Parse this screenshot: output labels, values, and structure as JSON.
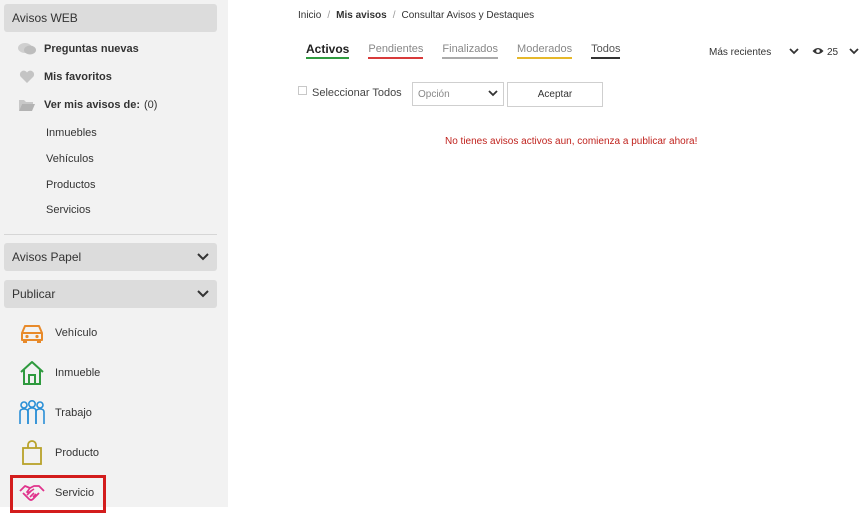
{
  "sidebar": {
    "avisos_web": {
      "title": "Avisos WEB",
      "preguntas": "Preguntas nuevas",
      "favoritos": "Mis favoritos",
      "ver_avisos": "Ver mis avisos de:",
      "ver_avisos_count": "(0)",
      "categories": [
        "Inmuebles",
        "Vehículos",
        "Productos",
        "Servicios"
      ]
    },
    "avisos_papel": {
      "title": "Avisos Papel"
    },
    "publicar": {
      "title": "Publicar",
      "items": [
        "Vehículo",
        "Inmueble",
        "Trabajo",
        "Producto",
        "Servicio"
      ]
    }
  },
  "breadcrumb": {
    "home": "Inicio",
    "sep": "/",
    "current": "Mis avisos",
    "page": "Consultar Avisos y Destaques"
  },
  "tabs": [
    "Activos",
    "Pendientes",
    "Finalizados",
    "Moderados",
    "Todos"
  ],
  "sort": {
    "label": "Más recientes"
  },
  "views": {
    "count": "25"
  },
  "toolbar": {
    "select_all": "Seleccionar Todos",
    "option_placeholder": "Opción",
    "accept": "Aceptar"
  },
  "empty_message": "No tienes avisos activos aun, comienza a publicar ahora!",
  "colors": {
    "active_tab": "#2e9a3e",
    "pending_tab": "#d83a3a",
    "moderated_tab": "#e6b82a",
    "message": "#c0231e",
    "highlight": "#d31d1d",
    "vehicle_icon": "#e88a2a",
    "property_icon": "#2e9a3e",
    "job_icon": "#2a8fd6",
    "product_icon": "#b8a22a",
    "service_icon": "#e0338c"
  }
}
